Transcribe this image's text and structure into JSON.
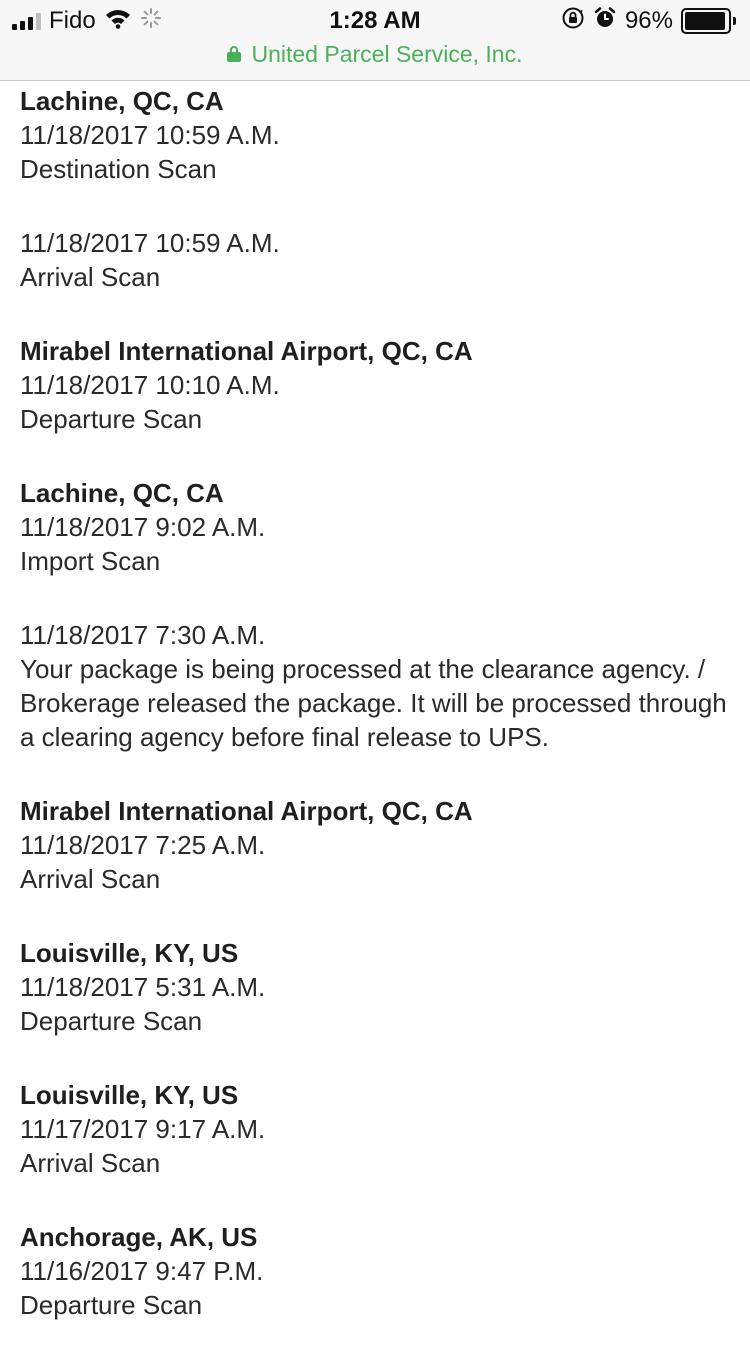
{
  "status_bar": {
    "carrier": "Fido",
    "time": "1:28 AM",
    "battery_percent": "96%",
    "battery_level": 0.96,
    "icons": [
      "signal-icon",
      "wifi-icon",
      "activity-spinner-icon",
      "orientation-lock-icon",
      "alarm-icon",
      "battery-icon"
    ]
  },
  "url_bar": {
    "site_name": "United Parcel Service, Inc.",
    "secure": true,
    "accent_color": "#4cb05a"
  },
  "tracking": {
    "entries": [
      {
        "location": "Lachine, QC, CA",
        "datetime": "11/18/2017 10:59 A.M.",
        "activity": "Destination Scan"
      },
      {
        "location": "",
        "datetime": "11/18/2017 10:59 A.M.",
        "activity": "Arrival Scan"
      },
      {
        "location": "Mirabel International Airport, QC, CA",
        "datetime": "11/18/2017 10:10 A.M.",
        "activity": "Departure Scan"
      },
      {
        "location": "Lachine, QC, CA",
        "datetime": "11/18/2017 9:02 A.M.",
        "activity": "Import Scan"
      },
      {
        "location": "",
        "datetime": "11/18/2017 7:30 A.M.",
        "activity": "Your package is being processed at the clearance agency. / Brokerage released the package. It will be processed through a clearing agency before final release to UPS."
      },
      {
        "location": "Mirabel International Airport, QC, CA",
        "datetime": "11/18/2017 7:25 A.M.",
        "activity": "Arrival Scan"
      },
      {
        "location": "Louisville, KY, US",
        "datetime": "11/18/2017 5:31 A.M.",
        "activity": "Departure Scan"
      },
      {
        "location": "Louisville, KY, US",
        "datetime": "11/17/2017 9:17 A.M.",
        "activity": "Arrival Scan"
      },
      {
        "location": "Anchorage, AK, US",
        "datetime": "11/16/2017 9:47 P.M.",
        "activity": "Departure Scan"
      }
    ]
  }
}
